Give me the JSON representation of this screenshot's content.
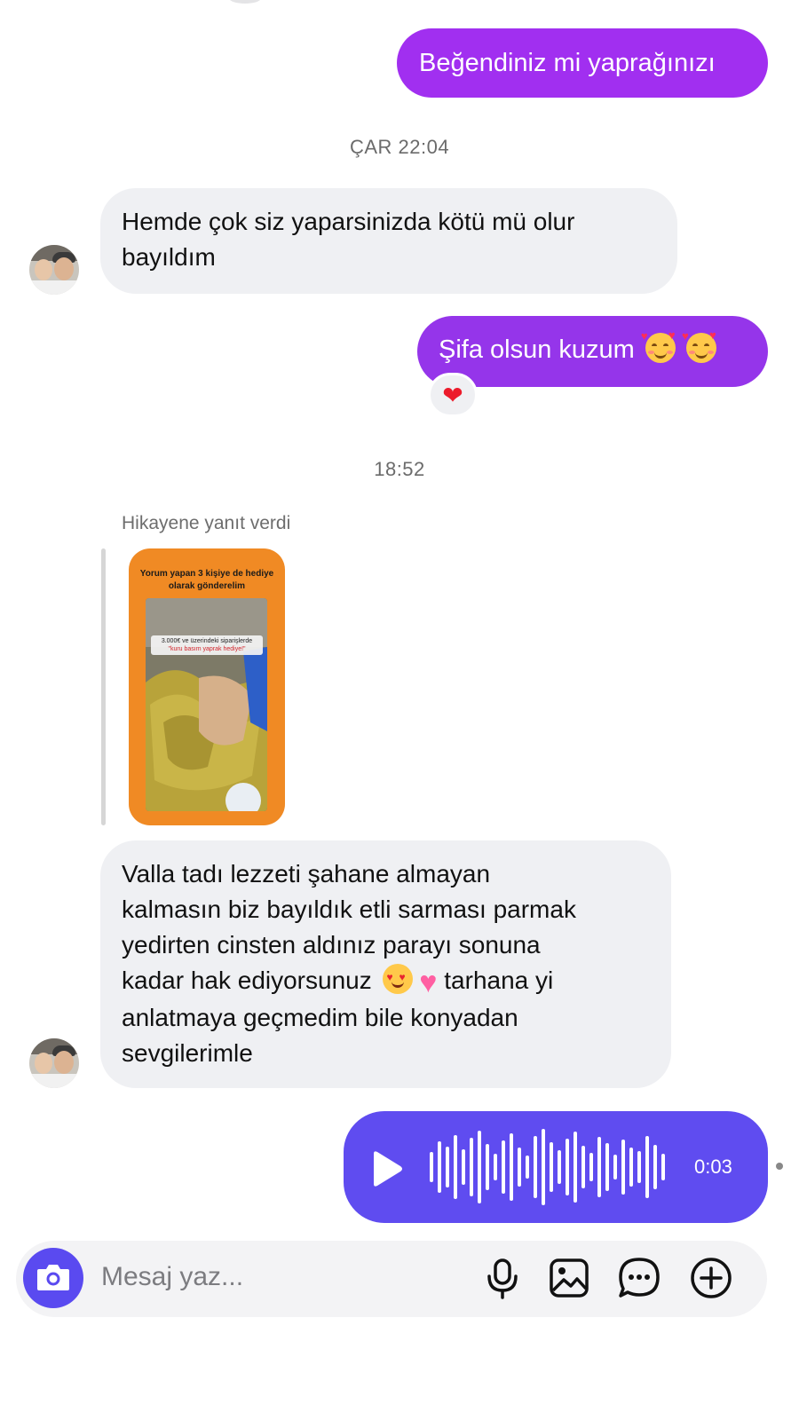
{
  "messages": {
    "m1": "Beğendiniz mi yaprağınızı",
    "stamp1": "ÇAR 22:04",
    "m2_line1": "Hemde çok siz yaparsinizda kötü mü olur",
    "m2_line2": "bayıldım",
    "m3": "Şifa olsun kuzum",
    "m3_reaction": "❤",
    "stamp2": "18:52",
    "story_caption": "Hikayene yanıt verdi",
    "story_title": "Yorum yapan 3 kişiye de hediye olarak gönderelim",
    "story_banner_1": "3.000€ ve üzerindeki siparişlerde",
    "story_banner_2": "\"kuru basım yaprak hediye!\"",
    "m4_l1": "Valla tadı lezzeti şahane almayan",
    "m4_l2": "kalmasın biz bayıldık etli sarması parmak",
    "m4_l3": "yedirten cinsten aldınız parayı sonuna",
    "m4_l4a": "kadar hak ediyorsunuz",
    "m4_l4b": "tarhana  yi",
    "m4_l5": "anlatmaya geçmedim bile konyadan",
    "m4_l6": "sevgilerimle",
    "voice_duration": "0:03"
  },
  "composer": {
    "placeholder": "Mesaj yaz..."
  },
  "icons": {
    "camera": "camera-icon",
    "mic": "microphone-icon",
    "gallery": "image-icon",
    "sticker": "chat-bubble-icon",
    "plus": "plus-circle-icon"
  },
  "colors": {
    "outgoing_gradient_start": "#9b2bf0",
    "outgoing_gradient_end": "#a32ee8",
    "outgoing_purple": "#8e3bea",
    "voice_blue": "#5f4cf0",
    "incoming_bg": "#eff0f3",
    "story_orange": "#f08a24"
  }
}
